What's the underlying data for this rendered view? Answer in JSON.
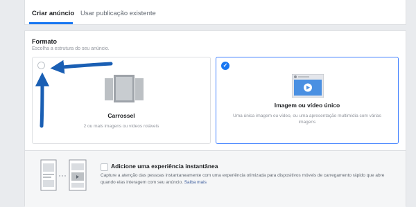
{
  "tabs": [
    {
      "label": "Criar anúncio",
      "active": true
    },
    {
      "label": "Usar publicação existente",
      "active": false
    }
  ],
  "format": {
    "title": "Formato",
    "subtitle": "Escolha a estrutura do seu anúncio."
  },
  "options": [
    {
      "title": "Carrossel",
      "description": "2 ou mais imagens ou vídeos roláveis",
      "selected": false
    },
    {
      "title": "Imagem ou vídeo único",
      "description": "Uma única imagem ou vídeo, ou uma apresentação multimídia com várias imagens",
      "selected": true
    }
  ],
  "instant": {
    "title": "Adicione uma experiência instantânea",
    "description": "Capture a atenção das pessoas instantaneamente com uma experiência otimizada para dispositivos móveis de carregamento rápido que abre quando elas interagem com seu anúncio.",
    "link": "Saiba mais"
  },
  "colors": {
    "accent": "#1877f2",
    "arrow": "#1a5fb4"
  }
}
